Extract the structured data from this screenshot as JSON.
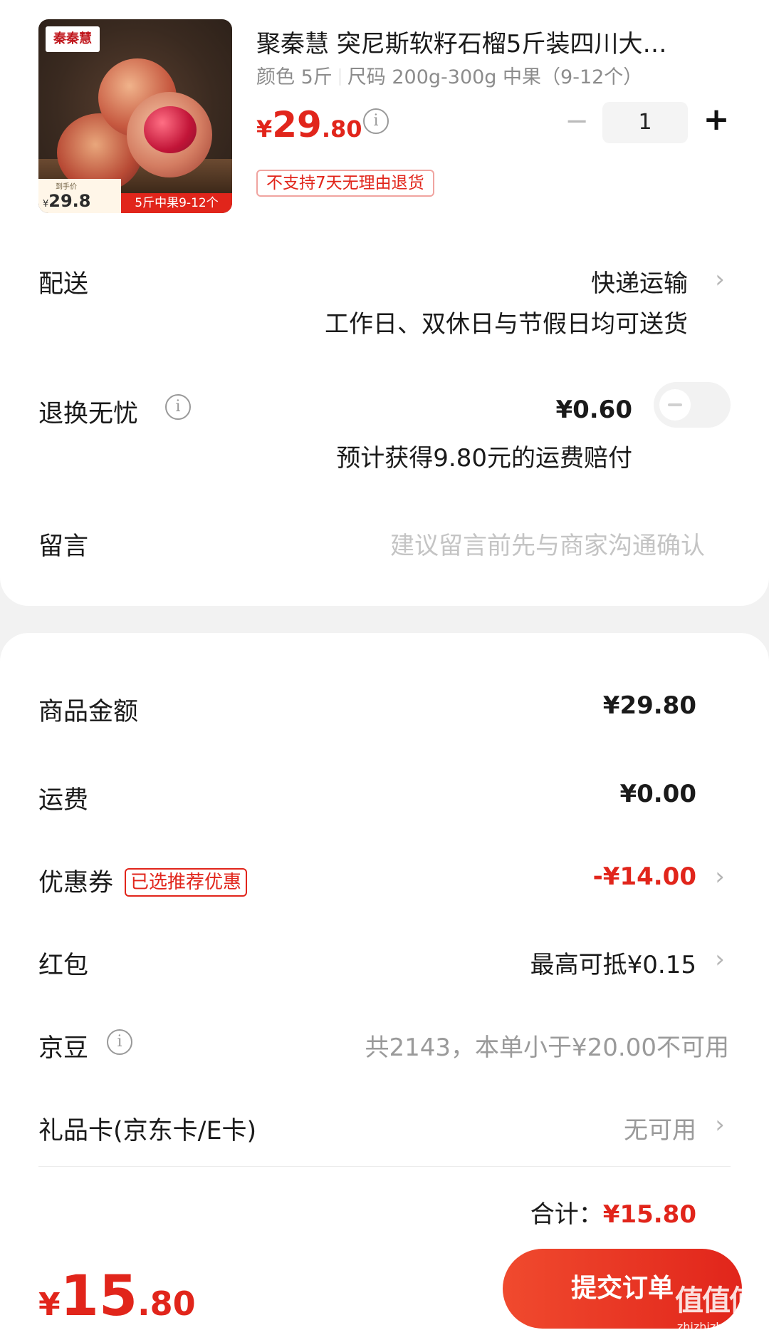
{
  "product": {
    "image_alt": "pomegranate",
    "brand_badge": "秦秦慧",
    "thumb_price_tag": "到手价",
    "thumb_currency": "¥",
    "thumb_price": "29.8",
    "thumb_spec": "5斤中果9-12个",
    "title": "聚秦慧 突尼斯软籽石榴5斤装四川大…",
    "spec_color": "颜色 5斤",
    "spec_size": "尺码 200g-300g 中果（9-12个）",
    "price_currency": "¥",
    "price_int": "29",
    "price_dec": ".80",
    "quantity": "1",
    "return_policy": "不支持7天无理由退货"
  },
  "delivery": {
    "label": "配送",
    "method": "快递运输",
    "note": "工作日、双休日与节假日均可送货"
  },
  "return_insurance": {
    "label": "退换无忧",
    "price": "¥0.60",
    "note": "预计获得9.80元的运费赔付"
  },
  "message": {
    "label": "留言",
    "placeholder": "建议留言前先与商家沟通确认"
  },
  "summary": {
    "goods_amount_label": "商品金额",
    "goods_amount": "¥29.80",
    "shipping_label": "运费",
    "shipping": "¥0.00",
    "coupon_label": "优惠券",
    "coupon_tag": "已选推荐优惠",
    "coupon_value": "-¥14.00",
    "redpacket_label": "红包",
    "redpacket_value": "最高可抵¥0.15",
    "jingdou_label": "京豆",
    "jingdou_value": "共2143，本单小于¥20.00不可用",
    "giftcard_label": "礼品卡(京东卡/E卡)",
    "giftcard_value": "无可用",
    "total_label": "合计：",
    "total_value": "¥15.80"
  },
  "bottom": {
    "currency": "¥",
    "price_int": "15",
    "price_dec": ".80",
    "submit_label": "提交订单"
  },
  "watermark": {
    "logo": "值值值",
    "url": "zhizhizhi.com"
  },
  "colors": {
    "accent": "#e1251b",
    "muted": "#999999",
    "background": "#f2f2f2"
  }
}
